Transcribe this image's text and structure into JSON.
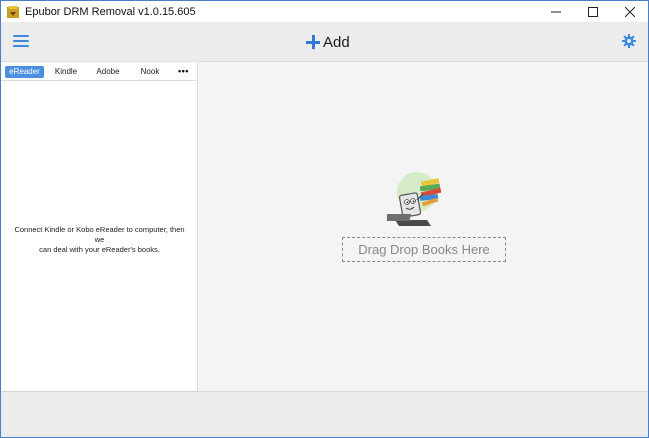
{
  "window": {
    "title": "Epubor DRM Removal v1.0.15.605",
    "controls": {
      "minimize_icon": "minimize-icon",
      "maximize_icon": "maximize-icon",
      "close_icon": "close-icon"
    }
  },
  "toolbar": {
    "menu_icon": "hamburger-menu-icon",
    "add_label": "Add",
    "settings_icon": "gear-icon",
    "accent_color": "#2e78d6"
  },
  "sidebar": {
    "tabs": [
      {
        "label": "eReader",
        "active": true
      },
      {
        "label": "Kindle",
        "active": false
      },
      {
        "label": "Adobe",
        "active": false
      },
      {
        "label": "Nook",
        "active": false
      }
    ],
    "more_label": "•••",
    "message_line1": "Connect Kindle or Kobo eReader to computer, then we",
    "message_line2": "can deal with your eReader's books."
  },
  "main": {
    "illustration_icon": "books-mascot-icon",
    "drop_label": "Drag Drop Books Here"
  }
}
